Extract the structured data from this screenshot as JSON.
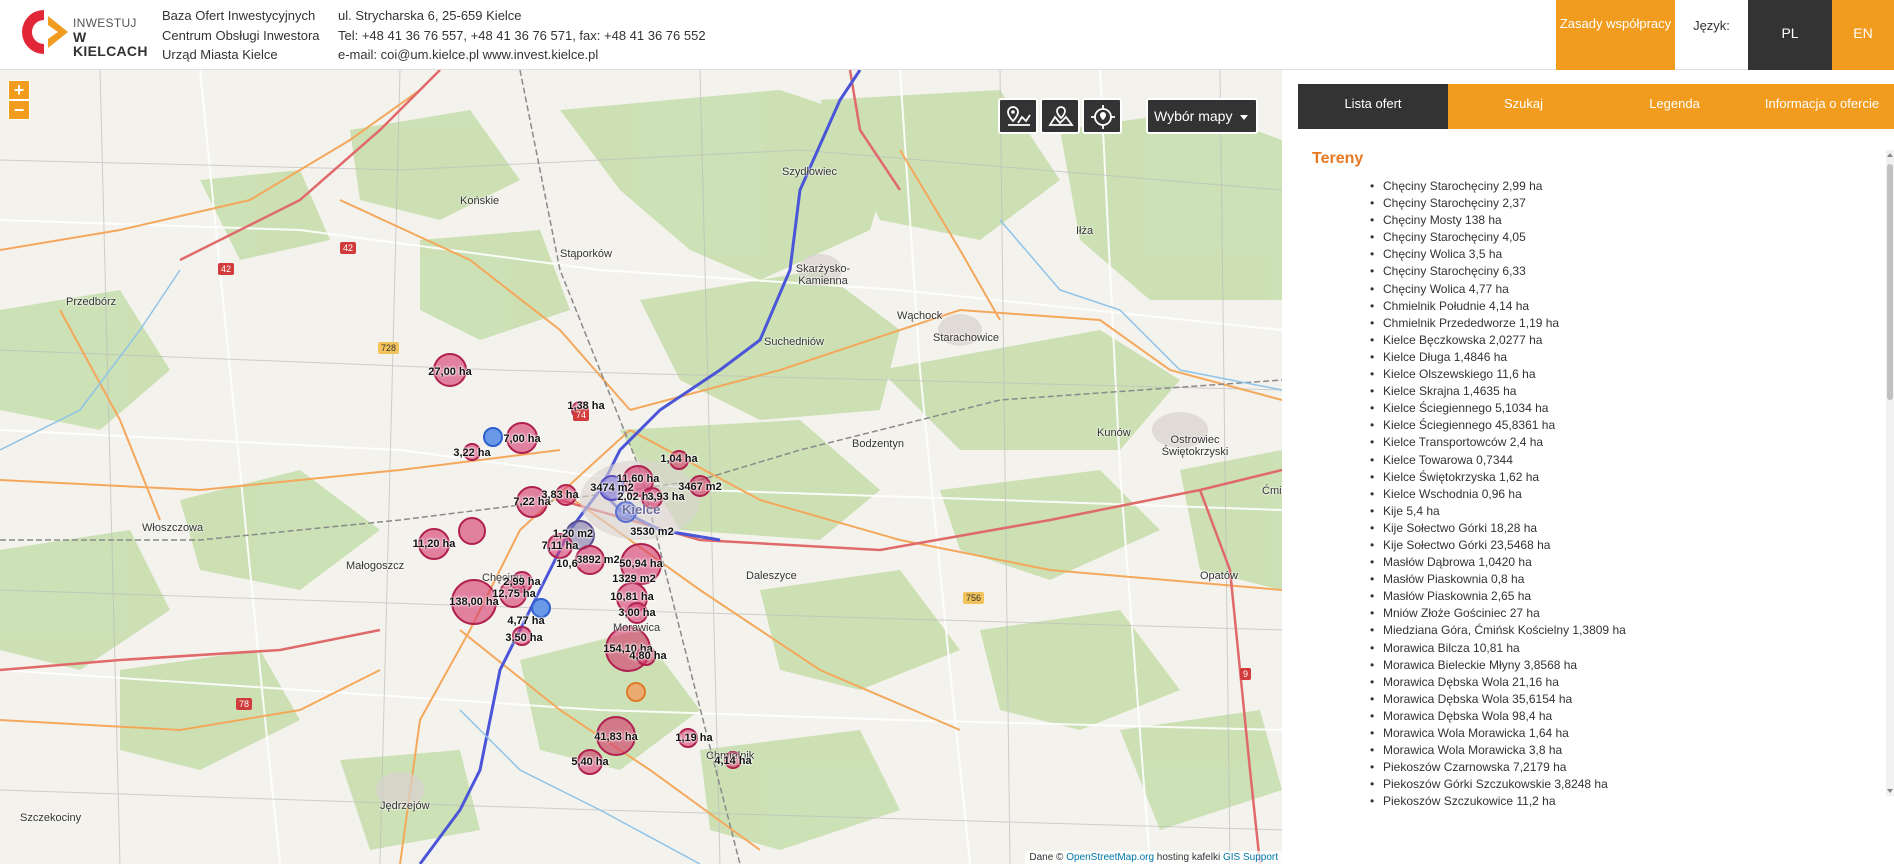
{
  "header": {
    "logo": {
      "line1": "INWESTUJ",
      "line2": "W KIELCACH"
    },
    "org": [
      "Baza Ofert Inwestycyjnych",
      "Centrum Obsługi Inwestora",
      "Urząd Miasta Kielce"
    ],
    "contact": {
      "address": "ul. Strycharska 6, 25-659 Kielce",
      "phones": "Tel: +48 41 36 76 557, +48 41 36 76 571, fax: +48 41 36 76 552",
      "email": "e-mail: coi@um.kielce.pl www.invest.kielce.pl"
    },
    "terms_button": "Zasady współpracy",
    "language_label": "Język:",
    "lang_pl": "PL",
    "lang_en": "EN"
  },
  "map": {
    "zoom_in": "+",
    "zoom_out": "−",
    "tools": [
      "route-marker-icon",
      "map-area-icon",
      "locate-icon"
    ],
    "map_select": "Wybór mapy",
    "attribution": {
      "prefix": "Dane © ",
      "link1": "OpenStreetMap.org",
      "mid": " hosting kafelki ",
      "link2": "GIS Support"
    },
    "towns": {
      "skarzysko": "Skarżysko-Kamienna",
      "szydlowiec": "Szydłowiec",
      "konskie": "Końskie",
      "stąporkow": "Stąporków",
      "przedborz": "Przedbórz",
      "ilza": "Iłża",
      "wachock": "Wąchock",
      "starachowice": "Starachowice",
      "suchedniow": "Suchedniów",
      "kunow": "Kunów",
      "ostrowiec": "Ostrowiec Świętokrzyski",
      "bodzentyn": "Bodzentyn",
      "kielce": "Kielce",
      "wloszczowa": "Włoszczowa",
      "malogoszcz": "Małogoszcz",
      "checiny": "Chęciny",
      "daleszyce": "Daleszyce",
      "opatow": "Opatów",
      "morawica": "Morawica",
      "jedrzejow": "Jędrzejów",
      "szczekociny": "Szczekociny",
      "chmielnik": "Chmielnik",
      "cmielow": "Ćmiel"
    },
    "road_badges": [
      "42",
      "42",
      "728",
      "74",
      "756",
      "78",
      "9"
    ],
    "markers": [
      "27,00 ha",
      "1,38 ha",
      "7,00 ha",
      "3,22 ha",
      "1,04 ha",
      "11,60 ha",
      "3474 m2",
      "2,02 ha",
      "3,93 ha",
      "3467 m2",
      "7,22 ha",
      "3,83 ha",
      "3530 m2",
      "11,20 ha",
      "1,20 m2",
      "7,11 ha",
      "3892 m2",
      "10,6",
      "50,94 ha",
      "1329 m2",
      "10,81 ha",
      "2,99 ha",
      "12,75 ha",
      "138,00 ha",
      "4,77 ha",
      "3,00 ha",
      "3,50 ha",
      "154,10 ha",
      "4,80 ha",
      "41,83 ha",
      "1,19 ha",
      "5,40 ha",
      "4,14 ha"
    ]
  },
  "sidebar": {
    "tabs": [
      "Lista ofert",
      "Szukaj",
      "Legenda",
      "Informacja o ofercie"
    ],
    "section_title": "Tereny",
    "offers": [
      "Chęciny Starochęciny 2,99 ha",
      "Chęciny Starochęciny 2,37",
      "Chęciny Mosty 138 ha",
      "Chęciny Starochęciny 4,05",
      "Chęciny Wolica 3,5 ha",
      "Chęciny Starochęciny 6,33",
      "Chęciny Wolica 4,77 ha",
      "Chmielnik Południe 4,14 ha",
      "Chmielnik Przededworze 1,19 ha",
      "Kielce Bęczkowska 2,0277 ha",
      "Kielce Długa 1,4846 ha",
      "Kielce Olszewskiego 11,6 ha",
      "Kielce Skrajna 1,4635 ha",
      "Kielce Ściegiennego 5,1034 ha",
      "Kielce Ściegiennego 45,8361 ha",
      "Kielce Transportowców 2,4 ha",
      "Kielce Towarowa 0,7344",
      "Kielce Świętokrzyska 1,62 ha",
      "Kielce Wschodnia 0,96 ha",
      "Kije 5,4 ha",
      "Kije Sołectwo Górki 18,28 ha",
      "Kije Sołectwo Górki 23,5468 ha",
      "Masłów Dąbrowa 1,0420 ha",
      "Masłów Piaskownia 0,8 ha",
      "Masłów Piaskownia 2,65 ha",
      "Mniów Złoże Gościniec 27 ha",
      "Miedziana Góra, Ćmińsk Kościelny 1,3809 ha",
      "Morawica Bilcza 10,81 ha",
      "Morawica Bieleckie Młyny 3,8568 ha",
      "Morawica Dębska Wola 21,16 ha",
      "Morawica Dębska Wola 35,6154 ha",
      "Morawica Dębska Wola 98,4 ha",
      "Morawica Wola Morawicka 1,64 ha",
      "Morawica Wola Morawicka 3,8 ha",
      "Piekoszów Czarnowska 7,2179 ha",
      "Piekoszów Górki Szczukowskie 3,8248 ha",
      "Piekoszów Szczukowice 11,2 ha"
    ]
  },
  "colors": {
    "accent": "#f29c1f",
    "dark": "#333333",
    "title": "#e87722",
    "marker": "#d6336c",
    "marker_blue": "#5b7fe0"
  }
}
